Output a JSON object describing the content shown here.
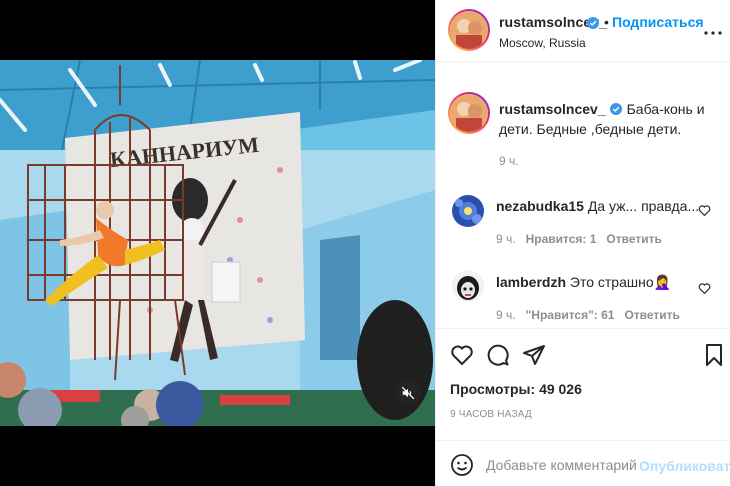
{
  "post": {
    "username": "rustamsolncev_",
    "follow_label": "Подписаться",
    "location": "Moscow, Russia",
    "caption": "Баба-конь и дети. Бедные ,бедные дети.",
    "caption_time": "9 ч."
  },
  "comments": [
    {
      "username": "nezabudka15",
      "text": "Да уж... правда...",
      "time": "9 ч.",
      "likes": "Нравится: 1",
      "reply": "Ответить"
    },
    {
      "username": "lamberdzh",
      "text": "Это страшно🤦‍♀️",
      "time": "9 ч.",
      "likes": "\"Нравится\": 61",
      "reply": "Ответить"
    }
  ],
  "stats": {
    "views_label": "Просмотры:",
    "views_value": "49 026",
    "posted_ago": "9 ЧАСОВ НАЗАД"
  },
  "composer": {
    "placeholder": "Добавьте комментарий...",
    "publish_label": "Опубликовать"
  },
  "video": {
    "banner_text": "КАННАРИУМ"
  },
  "icons": {
    "more": "more-icon",
    "like": "heart-icon",
    "comment": "comment-icon",
    "share": "share-icon",
    "save": "bookmark-icon",
    "emoji": "smile-icon",
    "mute": "muted-speaker-icon",
    "verified": "verified-badge-icon"
  },
  "colors": {
    "accent": "#0095f6",
    "publish_disabled": "#b2dffc",
    "verified": "#3897f0",
    "muted_text": "#8e8e8e"
  }
}
